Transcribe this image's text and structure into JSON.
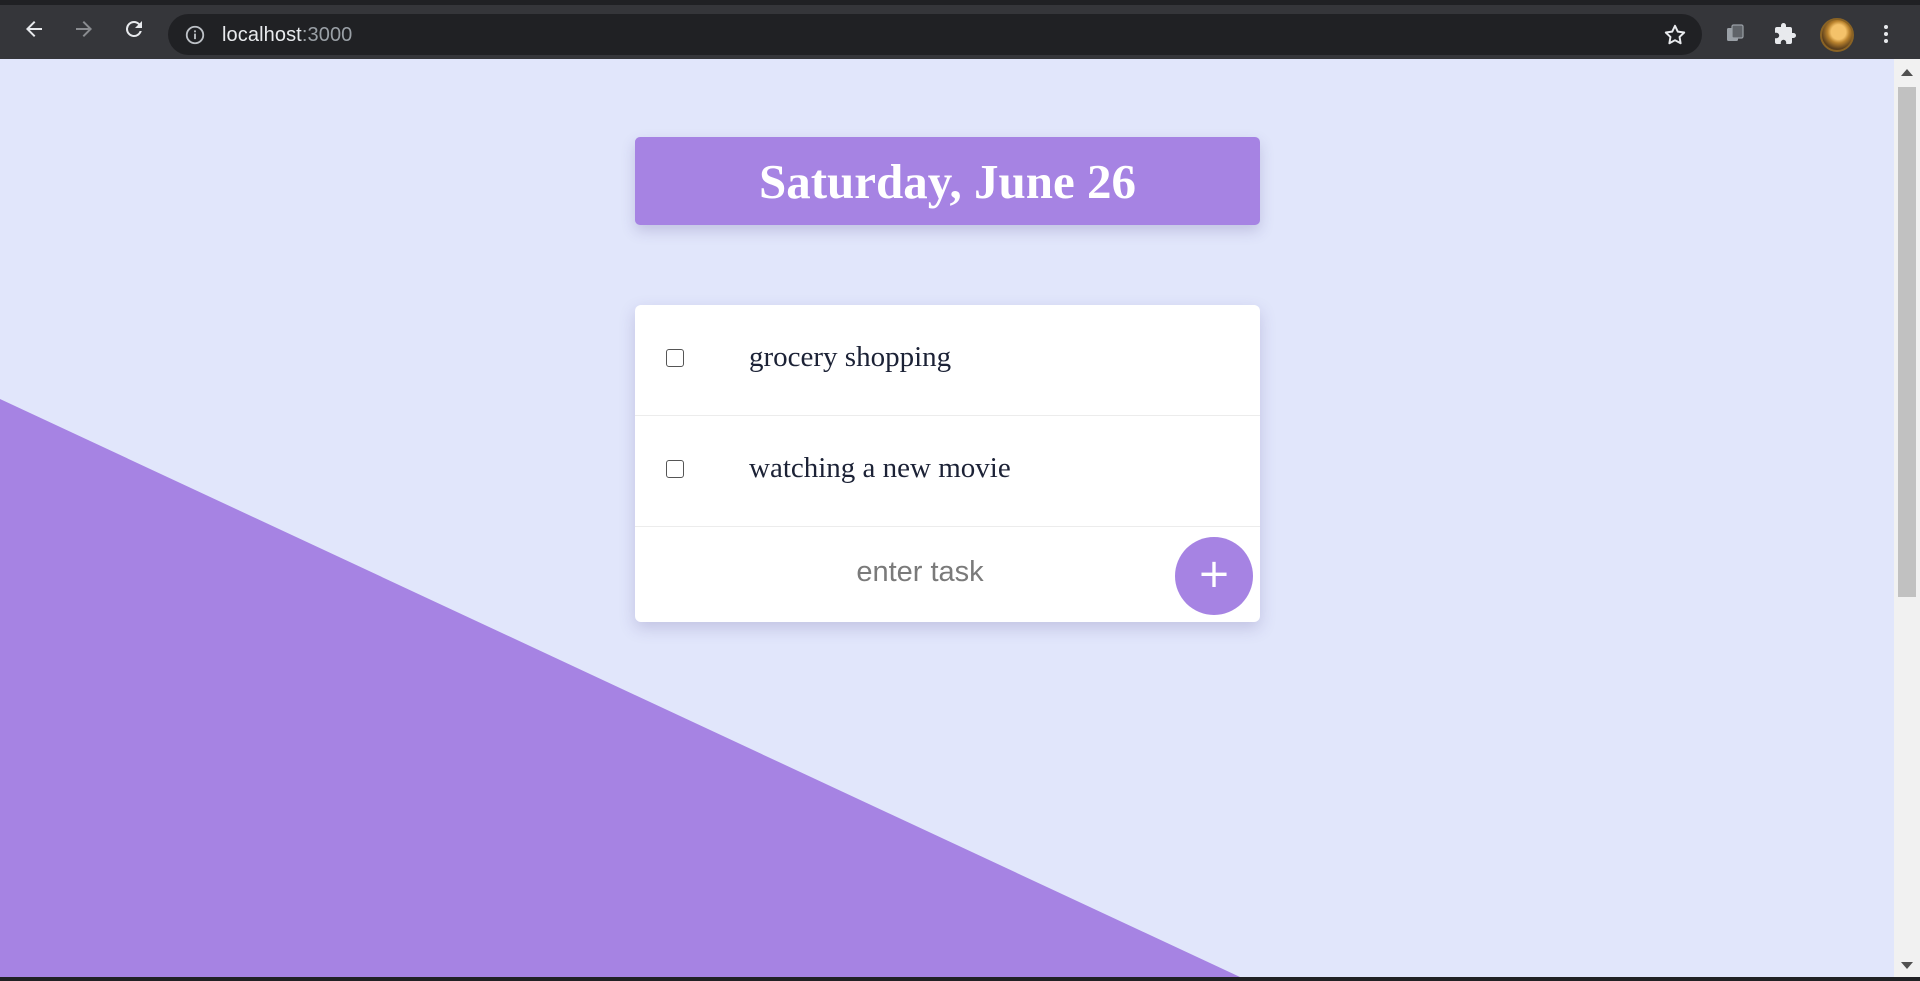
{
  "browser": {
    "url_host": "localhost",
    "url_port": ":3000"
  },
  "app": {
    "date_heading": "Saturday, June 26",
    "tasks": [
      {
        "text": "grocery shopping",
        "checked": false
      },
      {
        "text": "watching a new movie",
        "checked": false
      }
    ],
    "input_placeholder": "enter task",
    "add_label": "+"
  },
  "colors": {
    "accent": "#a683e3",
    "background": "#e1e6fb",
    "text": "#1c2236"
  },
  "icons": [
    "back-icon",
    "forward-icon",
    "reload-icon",
    "info-icon",
    "star-icon",
    "extension-puzzle-icon",
    "tab-search-icon",
    "menu-kebab-icon"
  ]
}
